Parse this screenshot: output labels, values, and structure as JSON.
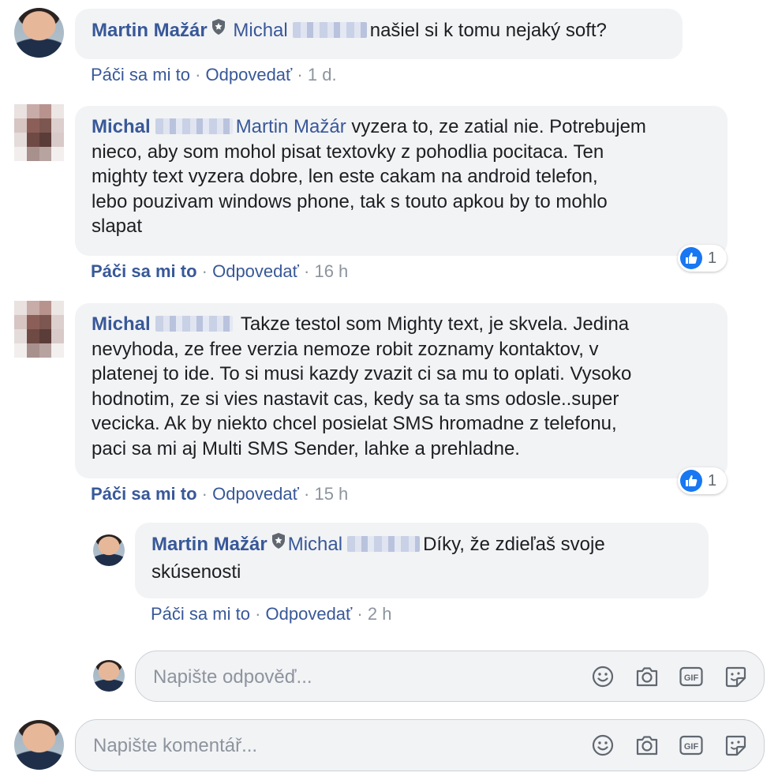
{
  "comments": [
    {
      "author": "Martin Mažár",
      "mention": "Michal",
      "text": "našiel si k tomu nejaký soft?",
      "like_label": "Páči sa mi to",
      "reply_label": "Odpovedať",
      "time": "1 d."
    },
    {
      "author": "Michal",
      "mention": "Martin Mažár",
      "text_lines": [
        "vyzera to, ze zatial nie. Potrebujem",
        "nieco, aby som mohol pisat textovky z pohodlia pocitaca. Ten",
        "mighty text vyzera dobre, len este cakam na android telefon,",
        "lebo pouzivam windows phone, tak s touto apkou by to mohlo",
        "slapat"
      ],
      "like_label": "Páči sa mi to",
      "reply_label": "Odpovedať",
      "time": "16 h",
      "reactions": "1"
    },
    {
      "author": "Michal",
      "text_lines": [
        "Takze testol som Mighty text, je skvela. Jedina",
        "nevyhoda, ze free verzia nemoze robit zoznamy kontaktov, v",
        "platenej to ide. To si musi kazdy zvazit ci sa mu to oplati. Vysoko",
        "hodnotim, ze si vies nastavit cas, kedy sa ta sms odosle..super",
        "vecicka. Ak by niekto chcel posielat SMS hromadne z telefonu,",
        "paci sa mi aj Multi SMS Sender, lahke a prehladne."
      ],
      "like_label": "Páči sa mi to",
      "reply_label": "Odpovedať",
      "time": "15 h",
      "reactions": "1"
    }
  ],
  "reply": {
    "author": "Martin Mažár",
    "mention": "Michal",
    "text_line1": "Díky, že zdieľaš svoje",
    "text_line2": "skúsenosti",
    "like_label": "Páči sa mi to",
    "reply_label": "Odpovedať",
    "time": "2 h"
  },
  "reply_composer": {
    "placeholder": "Napište odpověď..."
  },
  "comment_composer": {
    "placeholder": "Napište komentář..."
  },
  "separator": "·",
  "icons": [
    "emoji-icon",
    "camera-icon",
    "gif-icon",
    "sticker-icon"
  ],
  "colors": {
    "link": "#385898",
    "meta": "#8d949e",
    "bubble": "#f2f3f5",
    "like": "#1877f2"
  }
}
